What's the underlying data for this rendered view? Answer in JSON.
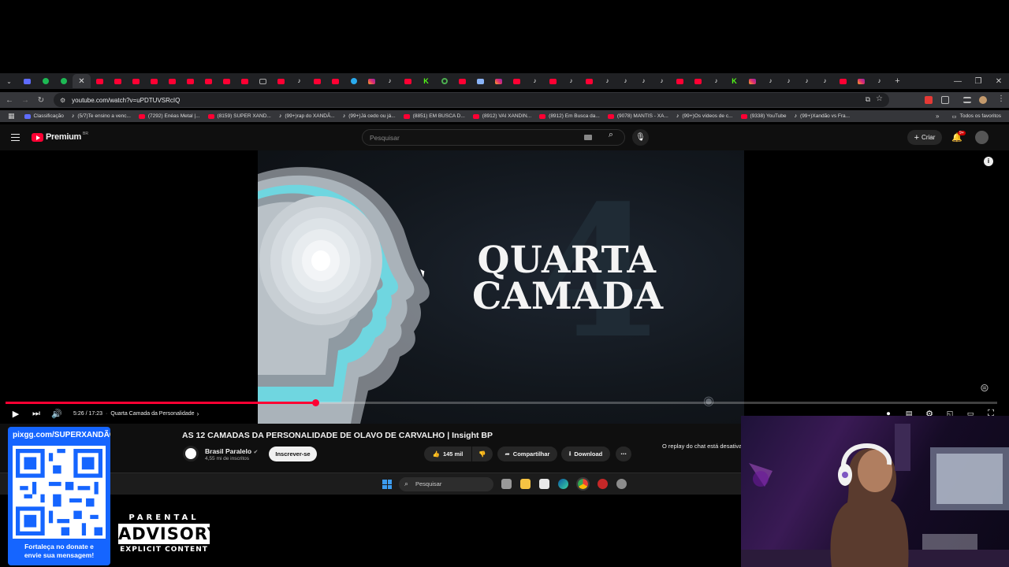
{
  "browser": {
    "url": "youtube.com/watch?v=uPDTUVSRcIQ",
    "tabs": [
      "yt",
      "yt",
      "yt",
      "yt",
      "yt",
      "yt",
      "yt",
      "yt",
      "yt",
      "sc",
      "yt",
      "tt",
      "yt",
      "yt",
      "tg",
      "ig",
      "tt",
      "yt",
      "kk",
      "gg",
      "yt",
      "gr",
      "ig",
      "yt",
      "tt",
      "yt",
      "tt",
      "yt",
      "tt",
      "tt",
      "tt",
      "tt",
      "yt",
      "yt",
      "tt",
      "kk",
      "ig",
      "tt",
      "tt",
      "tt",
      "tt",
      "yt",
      "ig",
      "tt"
    ],
    "bookmarks": [
      {
        "label": "Classificação",
        "icon": "cl"
      },
      {
        "label": "(5/7)Te ensino a venc...",
        "icon": "tt"
      },
      {
        "label": "(7292) Enéas Metal |...",
        "icon": "yt"
      },
      {
        "label": "(8159) SUPER XAND...",
        "icon": "yt"
      },
      {
        "label": "(99+)rap do XANDÃ...",
        "icon": "tt"
      },
      {
        "label": "(99+)Já cedo ou já...",
        "icon": "tt"
      },
      {
        "label": "(8851) EM BUSCA D...",
        "icon": "yt"
      },
      {
        "label": "(8912) VAI XANDIN...",
        "icon": "yt"
      },
      {
        "label": "(8912) Em Busca da...",
        "icon": "yt"
      },
      {
        "label": "(9078) MANTIS - XA...",
        "icon": "yt"
      },
      {
        "label": "(99+)Os vídeos de c...",
        "icon": "tt"
      },
      {
        "label": "(9338) YouTube",
        "icon": "yt"
      },
      {
        "label": "(99+)Xandão vs Fra...",
        "icon": "tt"
      }
    ],
    "all_bookmarks": "Todos os favoritos"
  },
  "youtube": {
    "logo": "Premium",
    "logo_country": "BR",
    "search_placeholder": "Pesquisar",
    "create_label": "Criar",
    "notifications": "9+"
  },
  "player": {
    "slide_title_line1": "QUARTA",
    "slide_title_line2": "CAMADA",
    "slide_bg_number": "4",
    "time": "5:26 / 17:23",
    "chapter": "Quarta Camada da Personalidade",
    "progress_fraction": 0.3125
  },
  "video": {
    "title": "AS 12 CAMADAS DA PERSONALIDADE DE OLAVO DE CARVALHO | Insight BP",
    "channel": "Brasil Paralelo",
    "subscribers": "4,55 mi de inscritos",
    "subscribe_label": "Inscrever-se",
    "likes": "145 mil",
    "share_label": "Compartilhar",
    "download_label": "Download",
    "chat_replay": "O replay do chat está desativado"
  },
  "taskbar": {
    "search_placeholder": "Pesquisar"
  },
  "overlay": {
    "donate_url": "pixgg.com/SUPERXANDÃO",
    "donate_caption_1": "Fortaleça no donate e",
    "donate_caption_2": "envie sua mensagem!",
    "advisory_top": "PARENTAL",
    "advisory_mid": "ADVISORY",
    "advisory_bot": "EXPLICIT CONTENT"
  },
  "colors": {
    "youtube_red": "#ff0033",
    "qr_box_blue": "#1565ff",
    "cyan_glow": "#6fd6e0"
  }
}
